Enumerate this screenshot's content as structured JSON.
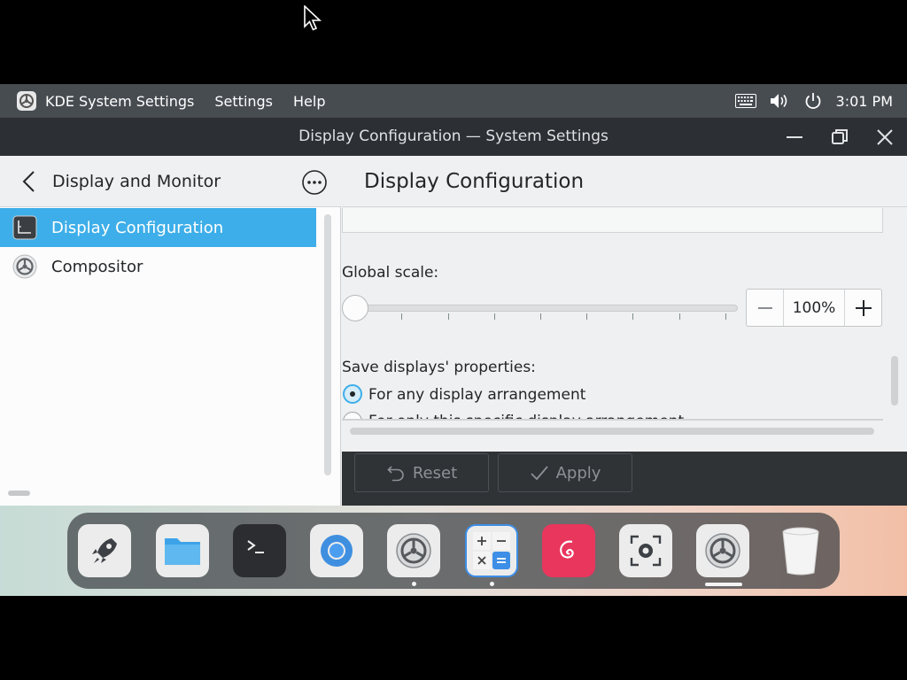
{
  "top_panel": {
    "app_name": "KDE System Settings",
    "menus": [
      "Settings",
      "Help"
    ],
    "icons": [
      "keyboard-icon",
      "volume-icon",
      "power-icon"
    ],
    "clock": "3:01 PM"
  },
  "window": {
    "title": "Display Configuration — System Settings",
    "buttons": [
      "minimize-icon",
      "restore-icon",
      "close-icon"
    ]
  },
  "sidebar": {
    "title": "Display and Monitor",
    "items": [
      {
        "label": "Display Configuration",
        "icon": "display-icon",
        "active": true
      },
      {
        "label": "Compositor",
        "icon": "compositor-icon",
        "active": false
      }
    ]
  },
  "main": {
    "title": "Display Configuration",
    "global_scale_label": "Global scale:",
    "scale_value": "100%",
    "scale_slider_fraction": 0,
    "save_label": "Save displays' properties:",
    "options": [
      {
        "label": "For any display arrangement",
        "checked": true
      },
      {
        "label": "For only this specific display arrangement",
        "checked": false
      }
    ]
  },
  "footer": {
    "reset_label": "Reset",
    "apply_label": "Apply"
  },
  "dock": {
    "apps": [
      "launcher-icon",
      "files-icon",
      "terminal-icon",
      "browser-icon",
      "settings-icon",
      "calculator-icon",
      "debian-icon",
      "screenshot-icon",
      "settings-icon",
      "trash-icon"
    ]
  },
  "colors": {
    "accent": "#3daee9",
    "panel": "#474c51",
    "titlebar": "#2c2f33"
  }
}
